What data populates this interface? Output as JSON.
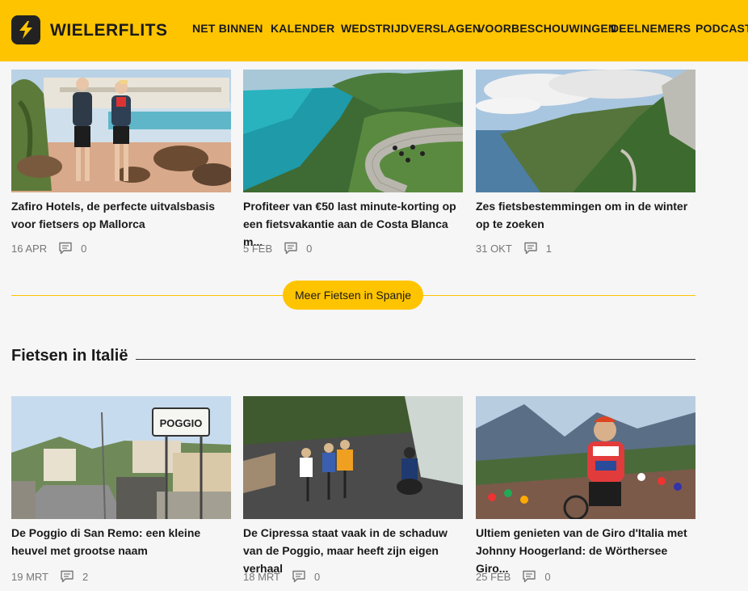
{
  "header": {
    "brand": "WIELERFLITS",
    "nav": [
      "NET BINNEN",
      "KALENDER",
      "WEDSTRIJDVERSLAGEN",
      "VOORBESCHOUWINGEN",
      "DEELNEMERS",
      "PODCAST"
    ],
    "background": "#ffc400"
  },
  "spain": {
    "cards": [
      {
        "title": "Zafiro Hotels, de perfecte uitvalsbasis voor fietsers op Mallorca",
        "date": "16 APR",
        "comments": "0"
      },
      {
        "title": "Profiteer van €50 last minute-korting op een fietsvakantie aan de Costa Blanca m...",
        "date": "5 FEB",
        "comments": "0"
      },
      {
        "title": "Zes fietsbestemmingen om in de winter op te zoeken",
        "date": "31 OKT",
        "comments": "1"
      }
    ],
    "more_label": "Meer Fietsen in Spanje"
  },
  "italy": {
    "heading": "Fietsen in Italië",
    "sign_text": "POGGIO",
    "cards": [
      {
        "title": "De Poggio di San Remo: een kleine heuvel met grootse naam",
        "date": "19 MRT",
        "comments": "2"
      },
      {
        "title": "De Cipressa staat vaak in de schaduw van de Poggio, maar heeft zijn eigen verhaal",
        "date": "18 MRT",
        "comments": "0"
      },
      {
        "title": "Ultiem genieten van de Giro d'Italia met Johnny Hoogerland: de Wörthersee Giro...",
        "date": "25 FEB",
        "comments": "0"
      }
    ]
  },
  "colors": {
    "accent": "#ffc400",
    "text": "#1a1a1a",
    "meta": "#777777"
  },
  "icons": {
    "logo": "lightning-bolt-logo-icon",
    "comment": "comment-bubble-icon"
  }
}
